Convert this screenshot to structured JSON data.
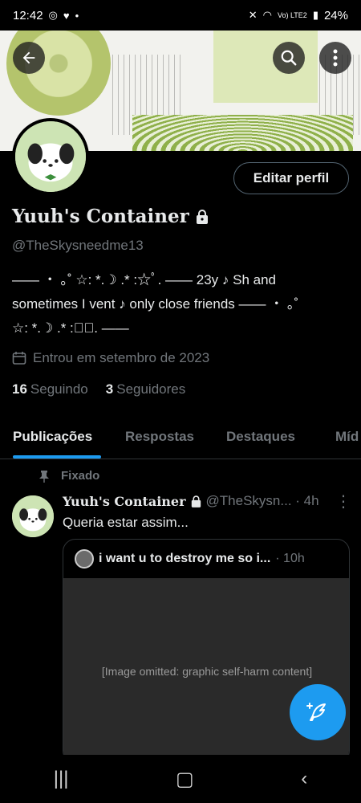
{
  "status_bar": {
    "time": "12:42",
    "battery": "24%",
    "network": "Vo) LTE2"
  },
  "profile": {
    "display_name": "Yuuh's Container",
    "handle": "@TheSkysneedme13",
    "edit_button": "Editar perfil",
    "bio_line1": "—— ・ ｡˚ ☆: *.☽ .* :☆ﾟ. —— 23y ♪ Sh and",
    "bio_line2": "sometimes I vent ♪ only close friends —— ・ ｡˚",
    "bio_line3": "☆: *.☽ .* :☆ﾟ. ——",
    "joined": "Entrou em setembro de 2023",
    "following_count": "16",
    "following_label": "Seguindo",
    "followers_count": "3",
    "followers_label": "Seguidores"
  },
  "tabs": [
    "Publicações",
    "Respostas",
    "Destaques",
    "Míd"
  ],
  "post": {
    "pinned_label": "Fixado",
    "author": "Yuuh's Container",
    "handle_time": "@TheSkysn... · 4h",
    "text": "Queria estar assim...",
    "quote": {
      "title": "i want u to destroy me so i...",
      "time": "· 10h",
      "media_note": "[Image omitted: graphic self-harm content]"
    }
  },
  "colors": {
    "accent": "#1d9bf0",
    "muted": "#71767b",
    "border": "#2f3336"
  }
}
